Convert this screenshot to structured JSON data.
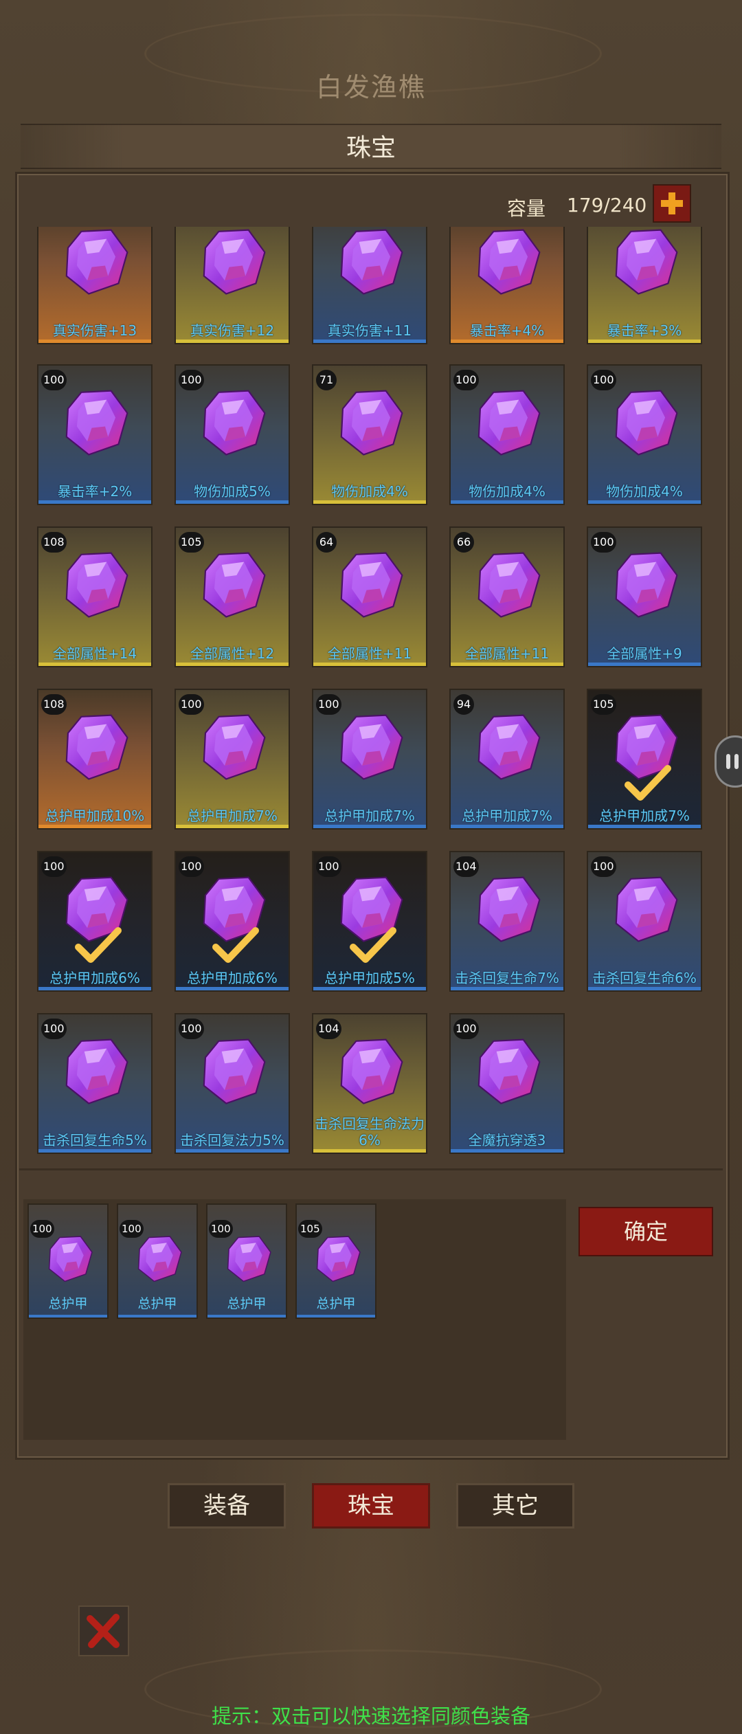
{
  "character_name": "白发渔樵",
  "title": "珠宝",
  "capacity": {
    "label": "容量",
    "value": "179/240"
  },
  "inventory": [
    {
      "level": "",
      "label": "真实伤害+13",
      "quality": "orange",
      "selected": false
    },
    {
      "level": "",
      "label": "真实伤害+12",
      "quality": "yellow",
      "selected": false
    },
    {
      "level": "",
      "label": "真实伤害+11",
      "quality": "blue",
      "selected": false
    },
    {
      "level": "",
      "label": "暴击率+4%",
      "quality": "orange",
      "selected": false
    },
    {
      "level": "",
      "label": "暴击率+3%",
      "quality": "yellow",
      "selected": false
    },
    {
      "level": "100",
      "label": "暴击率+2%",
      "quality": "blue",
      "selected": false
    },
    {
      "level": "100",
      "label": "物伤加成5%",
      "quality": "blue",
      "selected": false
    },
    {
      "level": "71",
      "label": "物伤加成4%",
      "quality": "yellow",
      "selected": false
    },
    {
      "level": "100",
      "label": "物伤加成4%",
      "quality": "blue",
      "selected": false
    },
    {
      "level": "100",
      "label": "物伤加成4%",
      "quality": "blue",
      "selected": false
    },
    {
      "level": "108",
      "label": "全部属性+14",
      "quality": "yellow",
      "selected": false
    },
    {
      "level": "105",
      "label": "全部属性+12",
      "quality": "yellow",
      "selected": false
    },
    {
      "level": "64",
      "label": "全部属性+11",
      "quality": "yellow",
      "selected": false
    },
    {
      "level": "66",
      "label": "全部属性+11",
      "quality": "yellow",
      "selected": false
    },
    {
      "level": "100",
      "label": "全部属性+9",
      "quality": "blue",
      "selected": false
    },
    {
      "level": "108",
      "label": "总护甲加成10%",
      "quality": "orange",
      "selected": false
    },
    {
      "level": "100",
      "label": "总护甲加成7%",
      "quality": "yellow",
      "selected": false
    },
    {
      "level": "100",
      "label": "总护甲加成7%",
      "quality": "blue",
      "selected": false
    },
    {
      "level": "94",
      "label": "总护甲加成7%",
      "quality": "blue",
      "selected": false
    },
    {
      "level": "105",
      "label": "总护甲加成7%",
      "quality": "blue",
      "selected": true
    },
    {
      "level": "100",
      "label": "总护甲加成6%",
      "quality": "blue",
      "selected": true
    },
    {
      "level": "100",
      "label": "总护甲加成6%",
      "quality": "blue",
      "selected": true
    },
    {
      "level": "100",
      "label": "总护甲加成5%",
      "quality": "blue",
      "selected": true
    },
    {
      "level": "104",
      "label": "击杀回复生命7%",
      "quality": "blue",
      "selected": false
    },
    {
      "level": "100",
      "label": "击杀回复生命6%",
      "quality": "blue",
      "selected": false
    },
    {
      "level": "100",
      "label": "击杀回复生命5%",
      "quality": "blue",
      "selected": false
    },
    {
      "level": "100",
      "label": "击杀回复法力5%",
      "quality": "blue",
      "selected": false
    },
    {
      "level": "104",
      "label": "击杀回复生命法力6%",
      "quality": "yellow",
      "selected": false
    },
    {
      "level": "100",
      "label": "全魔抗穿透3",
      "quality": "blue",
      "selected": false
    }
  ],
  "selected_items": [
    {
      "level": "100",
      "label": "总护甲"
    },
    {
      "level": "100",
      "label": "总护甲"
    },
    {
      "level": "100",
      "label": "总护甲"
    },
    {
      "level": "105",
      "label": "总护甲"
    }
  ],
  "confirm_label": "确定",
  "tabs": [
    {
      "label": "装备",
      "active": false
    },
    {
      "label": "珠宝",
      "active": true
    },
    {
      "label": "其它",
      "active": false
    }
  ],
  "hint": "提示：双击可以快速选择同颜色装备",
  "colors": {
    "quality_orange": "#e08a2c",
    "quality_yellow": "#d8c03a",
    "quality_blue": "#3a78c8",
    "label_text": "#5cc8f4",
    "hint_text": "#3fe14a",
    "button_red": "#8a1a14"
  },
  "icons": {
    "gem": "purple-gem-icon",
    "check": "checkmark-icon",
    "add": "plus-icon",
    "close": "x-icon"
  }
}
